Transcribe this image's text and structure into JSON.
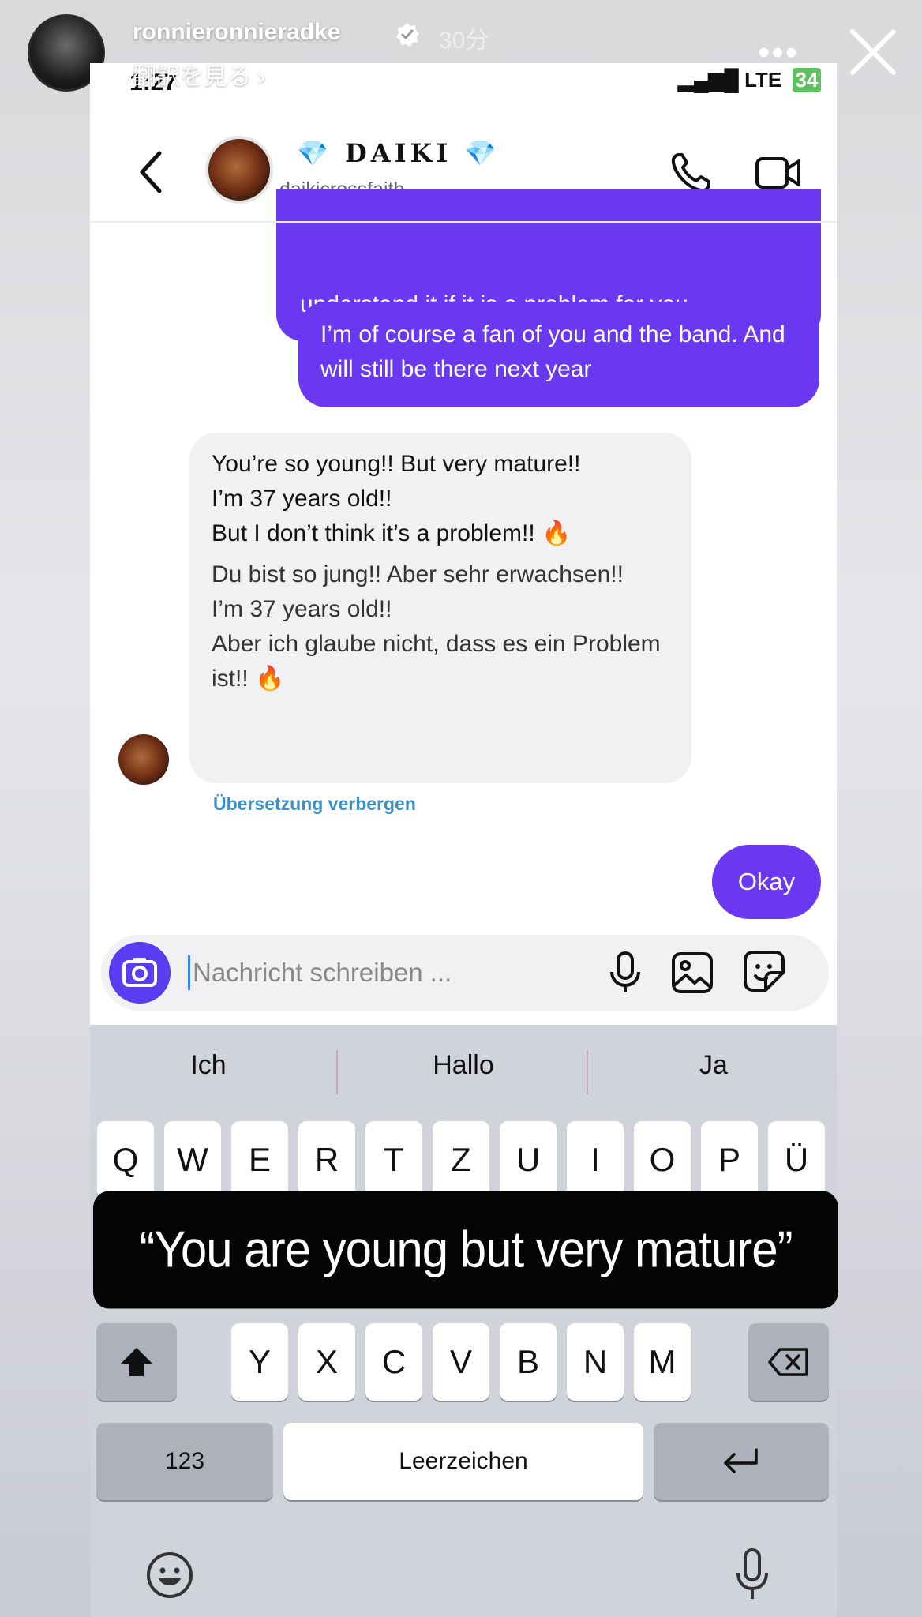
{
  "story": {
    "username": "ronnieronnieradke",
    "time_ago": "30分",
    "translate_label": "翻訳を見る ›",
    "more_icon": "more-dots-icon",
    "close_icon": "close-icon"
  },
  "status_bar": {
    "time": "1:27",
    "network": "LTE",
    "battery": "34"
  },
  "chat_header": {
    "name": "💎 DAIKI 💎",
    "handle": "daikicrossfaith"
  },
  "messages": {
    "out_1": "understand it if it is a problem for you.",
    "out_2": "I’m of course a fan of you and the band. And will still be there next year",
    "in_1": {
      "line1": "You’re so young!! But very mature!!",
      "line2": "I’m 37 years old!!",
      "line3": "But I don’t think it’s a problem!! 🔥",
      "trans1": "Du bist so jung!! Aber sehr erwachsen!!",
      "trans2": "I’m 37 years old!!",
      "trans3": "Aber ich glaube nicht, dass es ein Problem ist!! 🔥"
    },
    "hide_translation": "Übersetzung verbergen",
    "out_3": "Okay"
  },
  "composer": {
    "placeholder": "Nachricht schreiben ..."
  },
  "keyboard": {
    "suggestions": [
      "Ich",
      "Hallo",
      "Ja"
    ],
    "row1": [
      "Q",
      "W",
      "E",
      "R",
      "T",
      "Z",
      "U",
      "I",
      "O",
      "P",
      "Ü"
    ],
    "row3": [
      "Y",
      "X",
      "C",
      "V",
      "B",
      "N",
      "M"
    ],
    "numbers_label": "123",
    "space_label": "Leerzeichen"
  },
  "caption": "“You are young but very mature”",
  "colors": {
    "bubble_outgoing": "#6a38f0",
    "link_blue": "#3a90c7"
  }
}
